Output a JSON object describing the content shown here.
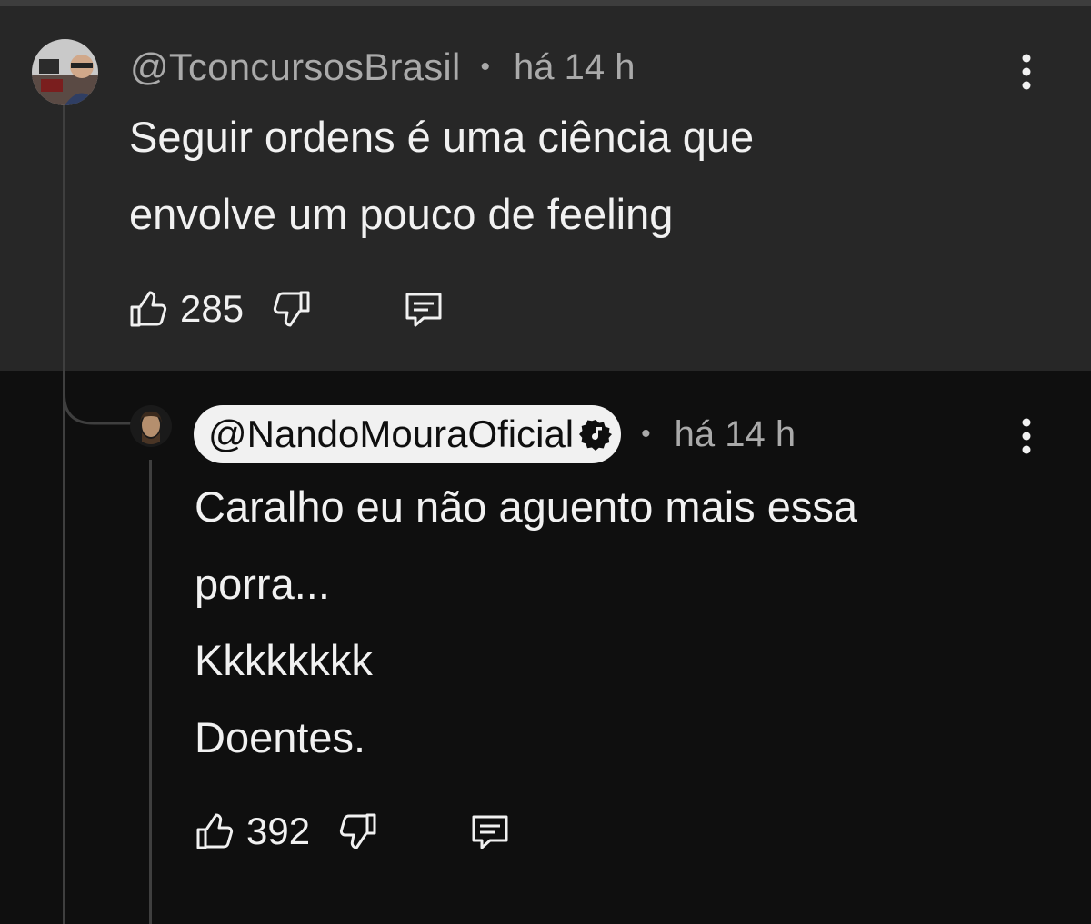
{
  "comment": {
    "handle": "@TconcursosBrasil",
    "separator": "•",
    "time": "há 14 h",
    "lines": [
      "Seguir ordens é uma ciência que",
      "envolve um pouco de feeling"
    ],
    "likes": "285"
  },
  "reply": {
    "handle": "@NandoMouraOficial",
    "separator": "•",
    "time": "há 14 h",
    "lines": [
      "Caralho eu não aguento mais essa",
      "porra...",
      "Kkkkkkkk",
      "Doentes."
    ],
    "likes": "392"
  },
  "icons": {
    "like": "thumbs-up-icon",
    "dislike": "thumbs-down-icon",
    "reply": "reply-comment-icon",
    "menu": "more-vertical-icon",
    "badge": "music-note-verified-icon"
  },
  "colors": {
    "background": "#0f0f0f",
    "highlight": "#272727",
    "text": "#f1f1f1",
    "muted": "#aaaaaa",
    "pill": "#f1f1f1"
  }
}
